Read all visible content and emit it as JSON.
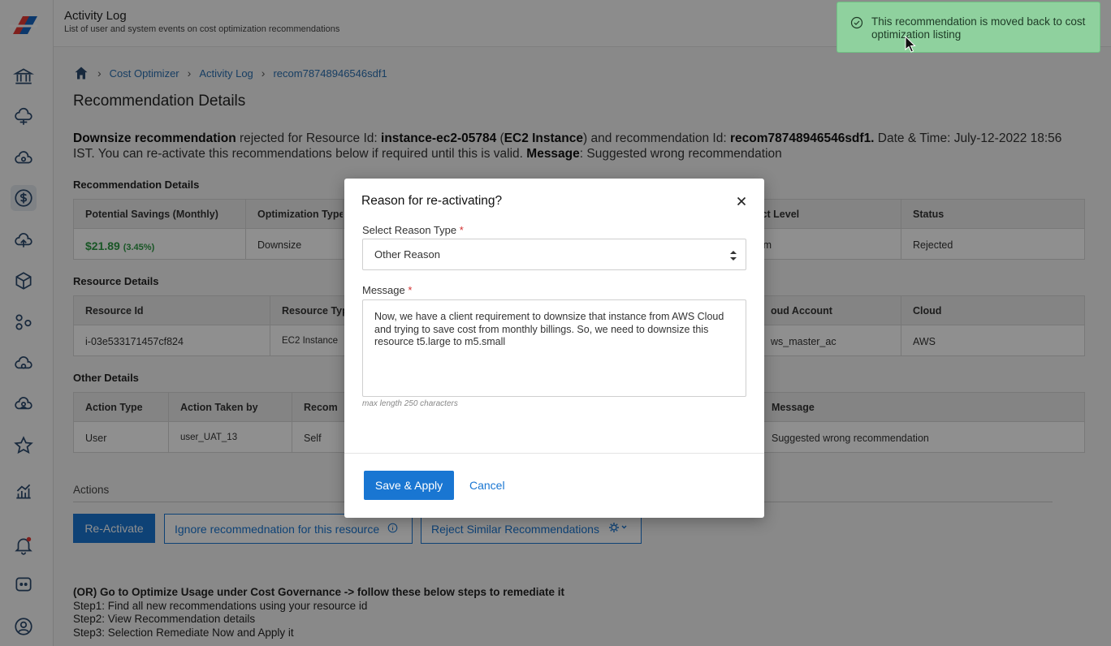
{
  "header": {
    "title": "Activity Log",
    "subtitle": "List of user and system events on cost optimization recommendations"
  },
  "breadcrumb": {
    "items": [
      "Cost Optimizer",
      "Activity Log",
      "recom78748946546sdf1"
    ]
  },
  "page": {
    "title": "Recommendation Details",
    "summary": {
      "type": "Downsize recommendation",
      "t1": " rejected for Resource Id: ",
      "resource_id": "instance-ec2-05784",
      "t2": " (",
      "resource_type": "EC2 Instance",
      "t3": ") and recommendation Id: ",
      "recommendation_id": "recom78748946546sdf1.",
      "t4": " Date & Time: July-12-2022 18:56 IST. You can re-activate this recommendations below if required until this is valid. ",
      "message_label": "Message",
      "message_value": ": Suggested wrong recommendation"
    }
  },
  "recommendation_details": {
    "title": "Recommendation Details",
    "headers": [
      "Potential Savings (Monthly)",
      "Optimization Type",
      "pact Level",
      "Status"
    ],
    "savings": "$21.89",
    "savings_pct": "(3.45%)",
    "optimization_type": "Downsize",
    "impact_level": "dium",
    "status": "Rejected"
  },
  "resource_details": {
    "title": "Resource Details",
    "headers": [
      "Resource Id",
      "Resource Typ",
      "oud Account",
      "Cloud"
    ],
    "values": [
      "i-03e533171457cf824",
      "EC2 Instance",
      "ws_master_ac",
      "AWS"
    ]
  },
  "other_details": {
    "title": "Other Details",
    "headers": [
      "Action Type",
      "Action Taken by",
      "Recom",
      "Message"
    ],
    "values": [
      "User",
      "user_UAT_13",
      "Self",
      "Suggested wrong recommendation"
    ]
  },
  "actions": {
    "title": "Actions",
    "reactivate": "Re-Activate",
    "ignore": "Ignore recommednation for this resource",
    "reject_similar": "Reject Similar Recommendations"
  },
  "steps": {
    "heading": "(OR) Go to Optimize Usage under Cost Governance -> follow these below steps to remediate it",
    "step1": "Step1: Find all new recommendations using your resource id",
    "step2": "Step2: View Recommendation details",
    "step3": "Step3: Selection Remediate Now and Apply it"
  },
  "modal": {
    "title": "Reason for re-activating?",
    "reason_label": "Select Reason Type",
    "reason_value": "Other Reason",
    "message_label": "Message",
    "required_mark": "*",
    "message_value": "Now, we have a client requirement to downsize that instance from AWS Cloud and trying to save cost from monthly billings. So, we need to downsize this resource t5.large to m5.small",
    "hint": "max length 250 characters",
    "save": "Save & Apply",
    "cancel": "Cancel"
  },
  "toast": {
    "message": "This recommendation is moved back to cost optimization listing"
  },
  "colors": {
    "primary": "#1976d2",
    "success_toast": "#8fd19e",
    "savings_green": "#2e9a44",
    "status_red": "#d44b3a"
  }
}
